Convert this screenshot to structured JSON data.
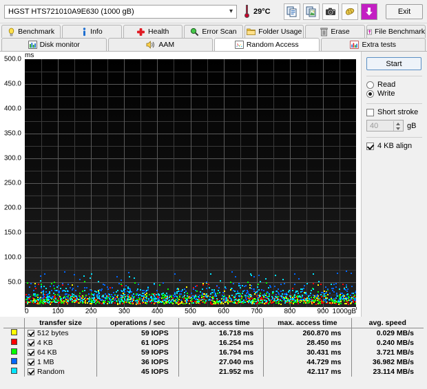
{
  "topbar": {
    "drive_label": "HGST HTS721010A9E630 (1000 gB)",
    "dropdown_chevron": "chevron-down-icon",
    "temperature": "29°C",
    "tools": [
      {
        "name": "copy-icon",
        "label": "Copy"
      },
      {
        "name": "copy-image-icon",
        "label": "Copy image"
      },
      {
        "name": "camera-icon",
        "label": "Screenshot"
      },
      {
        "name": "cookie-icon",
        "label": "Options"
      },
      {
        "name": "download-arrow-icon",
        "label": "Save"
      }
    ],
    "exit_label": "Exit"
  },
  "tabs_row1": [
    {
      "label": "Benchmark",
      "icon": "bulb-icon",
      "active": false
    },
    {
      "label": "Info",
      "icon": "info-icon",
      "active": false
    },
    {
      "label": "Health",
      "icon": "cross-icon",
      "active": false
    },
    {
      "label": "Error Scan",
      "icon": "magnifier-icon",
      "active": false
    },
    {
      "label": "Folder Usage",
      "icon": "folder-icon",
      "active": false
    },
    {
      "label": "Erase",
      "icon": "trash-icon",
      "active": false
    },
    {
      "label": "File Benchmark",
      "icon": "file-chart-icon",
      "active": false
    }
  ],
  "tabs_row2": [
    {
      "label": "Disk monitor",
      "icon": "bar-chart-icon",
      "active": false
    },
    {
      "label": "AAM",
      "icon": "speaker-icon",
      "active": false
    },
    {
      "label": "Random Access",
      "icon": "scatter-icon",
      "active": true
    },
    {
      "label": "Extra tests",
      "icon": "grid-chart-icon",
      "active": false
    }
  ],
  "panel": {
    "start_label": "Start",
    "mode_read": "Read",
    "mode_write": "Write",
    "mode_selected": "Write",
    "short_stroke_label": "Short stroke",
    "short_stroke_checked": false,
    "short_stroke_value": "40",
    "short_stroke_unit": "gB",
    "align_label": "4 KB align",
    "align_checked": true
  },
  "chart_data": {
    "type": "scatter",
    "title": "",
    "xlabel": "gB",
    "ylabel": "ms",
    "unit_label": "ms",
    "x_unit_suffix": "gB",
    "xlim": [
      0,
      1000
    ],
    "ylim": [
      0,
      500
    ],
    "grid": true,
    "y_ticks": [
      "500.0",
      "450.0",
      "400.0",
      "350.0",
      "300.0",
      "250.0",
      "200.0",
      "150.0",
      "100.0",
      "50.0"
    ],
    "y_tick_values": [
      500,
      450,
      400,
      350,
      300,
      250,
      200,
      150,
      100,
      50
    ],
    "y_minor_step": 25,
    "x_ticks": [
      "0",
      "100",
      "200",
      "300",
      "400",
      "500",
      "600",
      "700",
      "800",
      "900",
      "1000gB"
    ],
    "x_tick_values": [
      0,
      100,
      200,
      300,
      400,
      500,
      600,
      700,
      800,
      900,
      1000
    ],
    "series": [
      {
        "name": "512 bytes",
        "color": "#ffff00",
        "y_range_ms": [
          8,
          30
        ],
        "density": 330
      },
      {
        "name": "4 KB",
        "color": "#ff0000",
        "y_range_ms": [
          8,
          28
        ],
        "density": 330
      },
      {
        "name": "64 KB",
        "color": "#00ff00",
        "y_range_ms": [
          9,
          32
        ],
        "density": 330
      },
      {
        "name": "1 MB",
        "color": "#0066ff",
        "y_range_ms": [
          14,
          55
        ],
        "density": 380
      },
      {
        "name": "Random",
        "color": "#00e5ff",
        "y_range_ms": [
          10,
          48
        ],
        "density": 380
      }
    ],
    "note": "access-time scatter cloud concentrated between ~5 ms and ~55 ms across the full 0-1000 gB span"
  },
  "table": {
    "headers": [
      "transfer size",
      "operations / sec",
      "avg. access time",
      "max. access time",
      "avg. speed"
    ],
    "rows": [
      {
        "color": "#ffff00",
        "checked": true,
        "size": "512 bytes",
        "iops": "59 IOPS",
        "avg_access": "16.718 ms",
        "max_access": "260.870 ms",
        "avg_speed": "0.029 MB/s"
      },
      {
        "color": "#ff0000",
        "checked": true,
        "size": "4 KB",
        "iops": "61 IOPS",
        "avg_access": "16.254 ms",
        "max_access": "28.450 ms",
        "avg_speed": "0.240 MB/s"
      },
      {
        "color": "#00ff00",
        "checked": true,
        "size": "64 KB",
        "iops": "59 IOPS",
        "avg_access": "16.794 ms",
        "max_access": "30.431 ms",
        "avg_speed": "3.721 MB/s"
      },
      {
        "color": "#0066ff",
        "checked": true,
        "size": "1 MB",
        "iops": "36 IOPS",
        "avg_access": "27.040 ms",
        "max_access": "44.729 ms",
        "avg_speed": "36.982 MB/s"
      },
      {
        "color": "#00e5ff",
        "checked": true,
        "size": "Random",
        "iops": "45 IOPS",
        "avg_access": "21.952 ms",
        "max_access": "42.117 ms",
        "avg_speed": "23.114 MB/s"
      }
    ]
  }
}
